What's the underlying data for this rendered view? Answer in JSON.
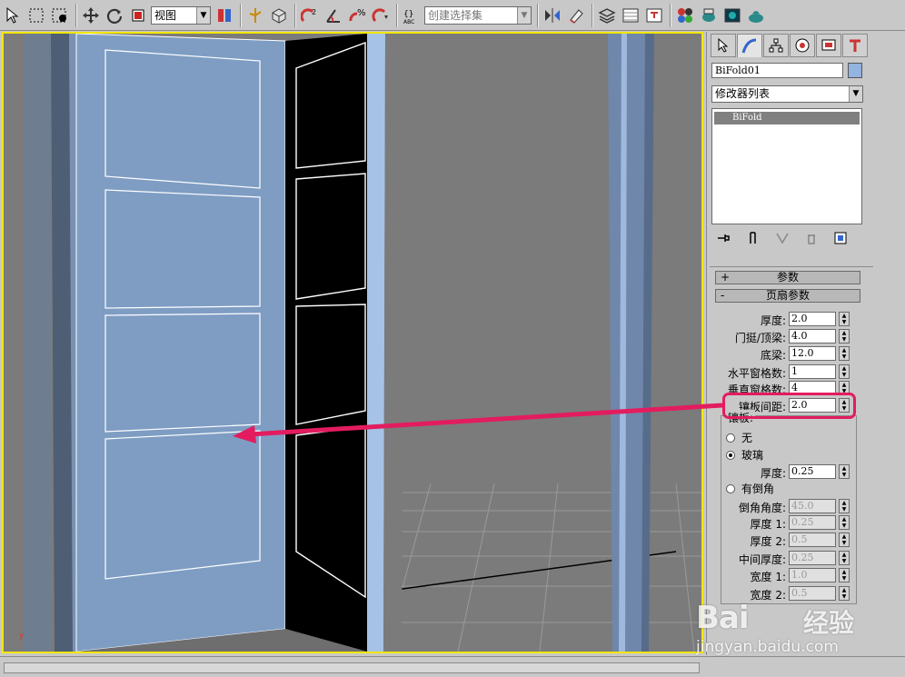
{
  "toolbar": {
    "view_select": "视图",
    "named_selection_placeholder": "创建选择集",
    "icons": [
      "select-icon",
      "region-select-icon",
      "select-by-name-icon",
      "move-icon",
      "rotate-icon",
      "scale-icon",
      "reference-coord-icon",
      "pivot-icon",
      "snap-icon",
      "angle-snap-icon",
      "percent-snap-icon",
      "spinner-snap-icon",
      "edit-named-selection-icon",
      "mirror-icon",
      "align-icon",
      "layers-icon",
      "curve-editor-icon",
      "schematic-view-icon",
      "material-editor-icon",
      "render-setup-icon",
      "render-frame-icon",
      "quick-render-icon"
    ]
  },
  "viewport": {
    "axis_label": "y"
  },
  "panel": {
    "object_name": "BiFold01",
    "object_color": "#93b3e0",
    "modifier_list": "修改器列表",
    "stack_item": "BiFold",
    "rollouts": {
      "params_sign": "+",
      "params_title": "参数",
      "leaf_sign": "-",
      "leaf_title": "页扇参数"
    },
    "params": [
      {
        "label": "厚度:",
        "value": "2.0"
      },
      {
        "label": "门挺/顶梁:",
        "value": "4.0"
      },
      {
        "label": "底梁:",
        "value": "12.0"
      },
      {
        "label": "水平窗格数:",
        "value": "1"
      },
      {
        "label": "垂直窗格数:",
        "value": "4"
      },
      {
        "label": "镶板间距:",
        "value": "2.0"
      }
    ],
    "panel_group": {
      "title": "镶板:",
      "option_none": "无",
      "option_glass": "玻璃",
      "glass_thickness_label": "厚度:",
      "glass_thickness_value": "0.25",
      "option_bevel": "有倒角"
    },
    "bevel_params": [
      {
        "label": "倒角角度:",
        "value": "45.0"
      },
      {
        "label": "厚度 1:",
        "value": "0.25"
      },
      {
        "label": "厚度 2:",
        "value": "0.5"
      },
      {
        "label": "中间厚度:",
        "value": "0.25"
      },
      {
        "label": "宽度 1:",
        "value": "1.0"
      },
      {
        "label": "宽度 2:",
        "value": "0.5"
      }
    ]
  },
  "watermark": {
    "brand": "Bai",
    "brand_cn": "经验",
    "url": "jingyan.baidu.com"
  },
  "annotation": {
    "color": "#e31c5f"
  }
}
